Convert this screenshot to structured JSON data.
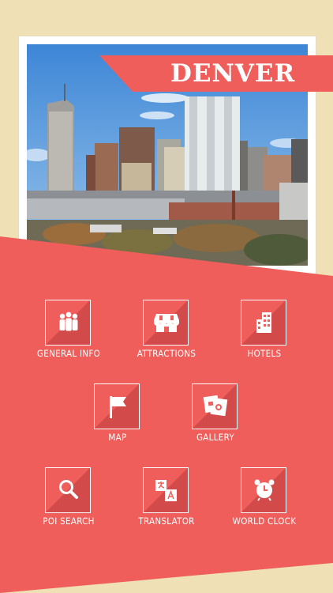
{
  "header": {
    "city_name": "DENVER"
  },
  "colors": {
    "accent": "#ef5e5b",
    "background": "#efe0b5",
    "icon_shadow": "#c94444"
  },
  "menu": {
    "items": [
      {
        "label": "GENERAL INFO",
        "icon": "people-icon"
      },
      {
        "label": "ATTRACTIONS",
        "icon": "shop-awning-icon"
      },
      {
        "label": "HOTELS",
        "icon": "building-icon"
      },
      {
        "label": "MAP",
        "icon": "flag-icon"
      },
      {
        "label": "GALLERY",
        "icon": "photos-icon"
      },
      {
        "label": "POI SEARCH",
        "icon": "magnifier-icon"
      },
      {
        "label": "TRANSLATOR",
        "icon": "translate-icon"
      },
      {
        "label": "WORLD CLOCK",
        "icon": "alarm-clock-icon"
      }
    ]
  }
}
